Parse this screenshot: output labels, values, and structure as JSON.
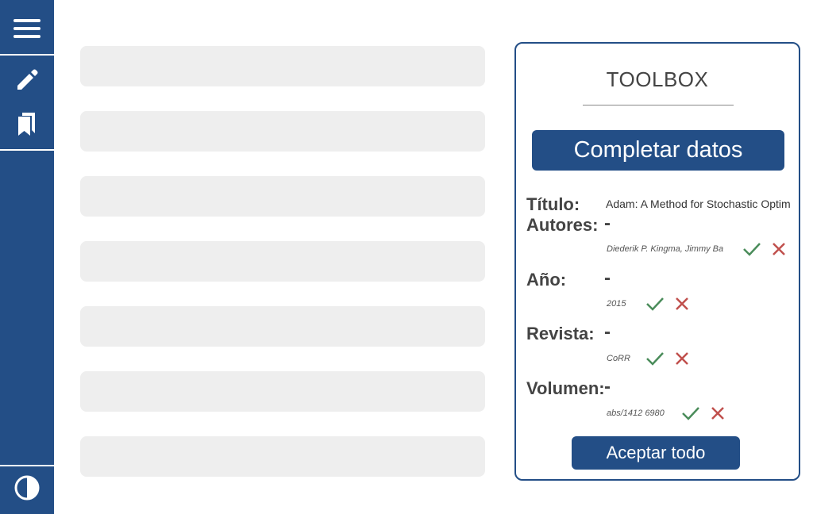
{
  "sidebar": {
    "icons": [
      "hamburger-menu-icon",
      "pencil-icon",
      "bookmarks-icon",
      "contrast-icon"
    ],
    "color": "#234e86"
  },
  "toolbox": {
    "title": "TOOLBOX",
    "complete_button": "Completar datos",
    "fields": {
      "titulo": {
        "label": "Título:",
        "value": "Adam: A Method for Stochastic Optimi"
      },
      "autores": {
        "label": "Autores:",
        "current": "-",
        "suggestion": "Diederik P. Kingma, Jimmy Ba"
      },
      "anio": {
        "label": "Año:",
        "current": "-",
        "suggestion": "2015"
      },
      "revista": {
        "label": "Revista:",
        "current": "-",
        "suggestion": "CoRR"
      },
      "volumen": {
        "label": "Volumen:",
        "current": "-",
        "suggestion": "abs/1412 6980"
      }
    },
    "accept_all_button": "Aceptar todo",
    "colors": {
      "accept": "#4a8c5a",
      "reject": "#c0504d",
      "brand": "#234e86"
    }
  }
}
